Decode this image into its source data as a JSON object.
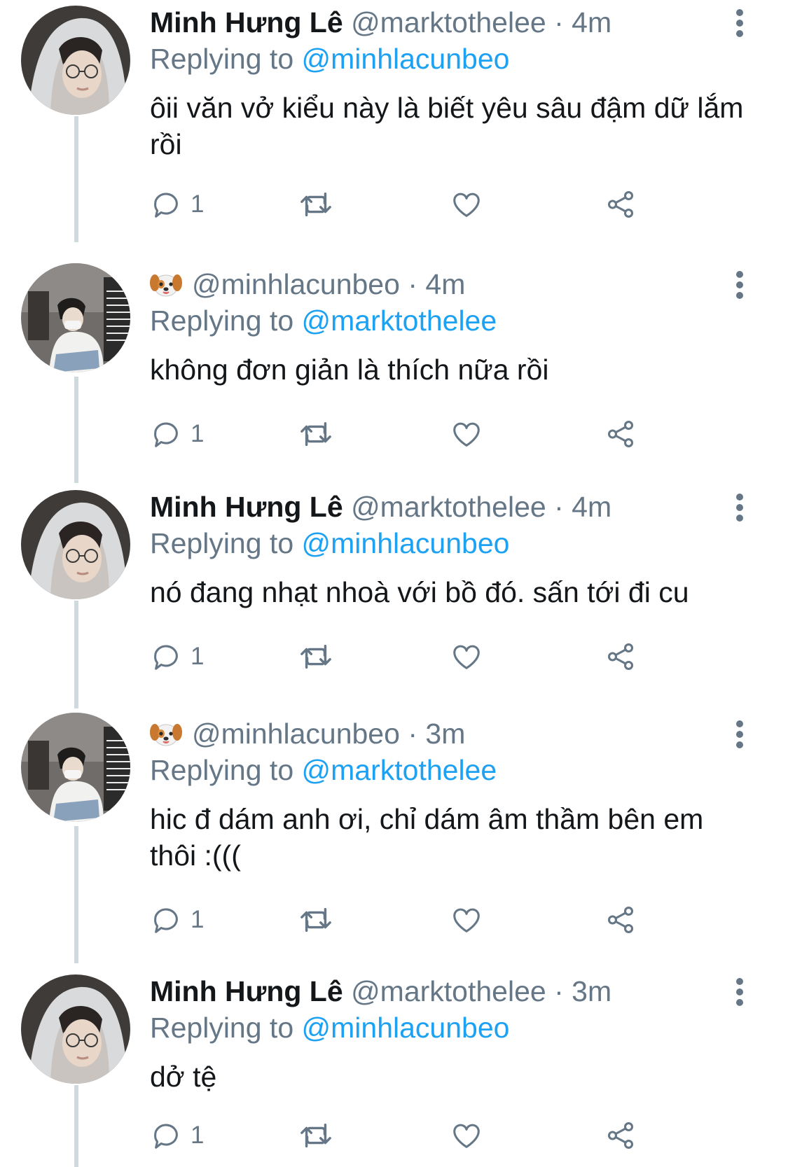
{
  "tweets": [
    {
      "author": "hung",
      "name": "Minh Hưng Lê",
      "handle": "@marktothelee",
      "sep": "·",
      "time": "4m",
      "replying_prefix": "Replying to",
      "replying_to": "@minhlacunbeo",
      "text": "ôii văn vở kiểu này là biết yêu sâu đậm dữ lắm rồi",
      "reply_count": "1"
    },
    {
      "author": "cunbeo",
      "name": "",
      "name_icon": "dog-face-emoji-icon",
      "handle": "@minhlacunbeo",
      "sep": "·",
      "time": "4m",
      "replying_prefix": "Replying to",
      "replying_to": "@marktothelee",
      "text": "không đơn giản là thích nữa rồi",
      "reply_count": "1"
    },
    {
      "author": "hung",
      "name": "Minh Hưng Lê",
      "handle": "@marktothelee",
      "sep": "·",
      "time": "4m",
      "replying_prefix": "Replying to",
      "replying_to": "@minhlacunbeo",
      "text": "nó đang nhạt nhoà với bồ đó. sấn tới đi cu",
      "reply_count": "1"
    },
    {
      "author": "cunbeo",
      "name": "",
      "name_icon": "dog-face-emoji-icon",
      "handle": "@minhlacunbeo",
      "sep": "·",
      "time": "3m",
      "replying_prefix": "Replying to",
      "replying_to": "@marktothelee",
      "text": "hic đ dám anh ơi, chỉ dám âm thầm bên em thôi :(((",
      "reply_count": "1"
    },
    {
      "author": "hung",
      "name": "Minh Hưng Lê",
      "handle": "@marktothelee",
      "sep": "·",
      "time": "3m",
      "replying_prefix": "Replying to",
      "replying_to": "@minhlacunbeo",
      "text": "dở tệ",
      "reply_count": "1"
    }
  ],
  "icons": {
    "reply": "reply-bubble-icon",
    "retweet": "retweet-icon",
    "like": "heart-icon",
    "share": "share-icon",
    "more": "more-vertical-icon"
  },
  "colors": {
    "text": "#14171a",
    "secondary": "#657786",
    "link": "#1da1f2",
    "thread_line": "#cfd9de"
  }
}
